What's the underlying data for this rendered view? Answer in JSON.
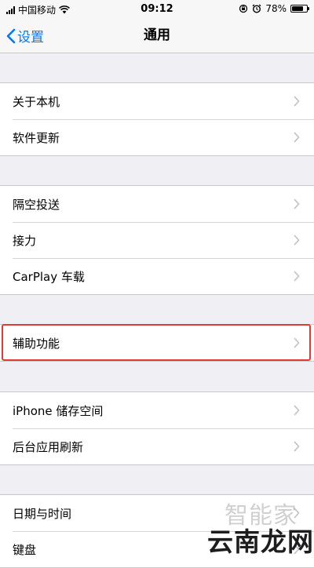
{
  "status_bar": {
    "carrier": "中国移动",
    "time": "09:12",
    "battery_percent": "78%",
    "battery_level": 0.78,
    "icons": [
      "signal-icon",
      "wifi-icon",
      "orientation-lock-icon",
      "alarm-icon",
      "battery-icon"
    ]
  },
  "nav": {
    "back_label": "设置",
    "title": "通用"
  },
  "groups": [
    {
      "items": [
        {
          "label": "关于本机"
        },
        {
          "label": "软件更新"
        }
      ]
    },
    {
      "items": [
        {
          "label": "隔空投送"
        },
        {
          "label": "接力"
        },
        {
          "label": "CarPlay 车载"
        }
      ]
    },
    {
      "items": [
        {
          "label": "辅助功能",
          "highlighted": true
        }
      ]
    },
    {
      "items": [
        {
          "label": "iPhone 储存空间"
        },
        {
          "label": "后台应用刷新"
        }
      ]
    },
    {
      "items": [
        {
          "label": "日期与时间"
        },
        {
          "label": "键盘"
        }
      ]
    }
  ],
  "colors": {
    "accent": "#007aff",
    "highlight": "#e53935",
    "background": "#efeff4"
  },
  "watermark": {
    "line1": "智能家",
    "line2": "云南龙网"
  }
}
